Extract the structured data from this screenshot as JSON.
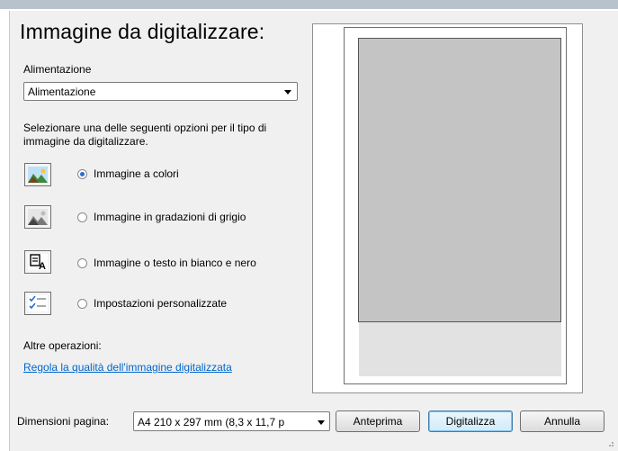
{
  "heading": "Immagine da digitalizzare:",
  "feed": {
    "label": "Alimentazione",
    "selected": "Alimentazione"
  },
  "description": "Selezionare una delle seguenti opzioni per il tipo di immagine da digitalizzare.",
  "options": [
    {
      "label": "Immagine a colori",
      "checked": true,
      "icon": "color-photo-icon"
    },
    {
      "label": "Immagine in gradazioni di grigio",
      "checked": false,
      "icon": "grayscale-photo-icon"
    },
    {
      "label": "Immagine o testo in bianco e nero",
      "checked": false,
      "icon": "black-white-text-icon"
    },
    {
      "label": "Impostazioni personalizzate",
      "checked": false,
      "icon": "custom-settings-icon"
    }
  ],
  "other_ops": {
    "label": "Altre operazioni:",
    "link": "Regola la qualità dell'immagine digitalizzata"
  },
  "footer": {
    "page_size_label": "Dimensioni pagina:",
    "page_size_value": "A4 210 x 297 mm (8,3 x 11,7 p",
    "preview_button": "Anteprima",
    "scan_button": "Digitalizza",
    "cancel_button": "Annulla"
  },
  "colors": {
    "link": "#0066cc",
    "radio_selected": "#2a6bd8",
    "preview_page": "#c4c4c4",
    "dialog_bg": "#f0f0f0"
  }
}
